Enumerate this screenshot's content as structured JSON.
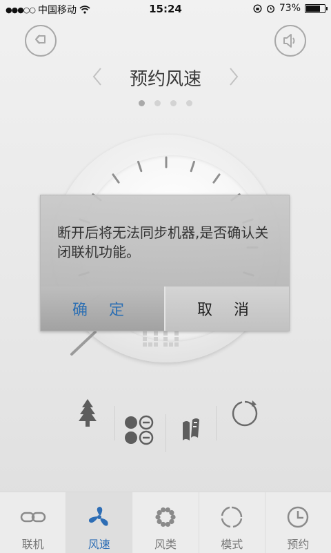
{
  "status_bar": {
    "carrier": "中国移动",
    "time": "15:24",
    "battery_pct": "73%",
    "signal_icon": "signal-dots-icon",
    "wifi_icon": "wifi-icon",
    "alarm_icon": "alarm-icon",
    "lock_rotation_icon": "rotation-lock-icon",
    "battery_level": 0.73
  },
  "header": {
    "back_icon": "back-arrow-icon",
    "sound_icon": "speaker-icon",
    "title": "预约风速",
    "prev_icon": "chevron-left-icon",
    "next_icon": "chevron-right-icon",
    "pager_count": 4,
    "pager_active": 0
  },
  "dialog": {
    "message": "断开后将无法同步机器,是否确认关闭联机功能。",
    "confirm_label": "确 定",
    "cancel_label": "取 消"
  },
  "modes": [
    {
      "name": "tree-mode",
      "icon": "tree-icon"
    },
    {
      "name": "circles-mode",
      "icon": "four-circles-icon"
    },
    {
      "name": "swing-mode",
      "icon": "swing-icon"
    },
    {
      "name": "cycle-mode",
      "icon": "cycle-icon"
    }
  ],
  "tabs": [
    {
      "label": "联机",
      "icon": "link-icon",
      "active": false
    },
    {
      "label": "风速",
      "icon": "fan-icon",
      "active": true
    },
    {
      "label": "风类",
      "icon": "flower-dots-icon",
      "active": false
    },
    {
      "label": "模式",
      "icon": "mode-circle-icon",
      "active": false
    },
    {
      "label": "预约",
      "icon": "clock-icon",
      "active": false
    }
  ],
  "colors": {
    "accent": "#2d6db5",
    "confirm_text": "#2c6fb3",
    "background": "#e9e9e9"
  }
}
